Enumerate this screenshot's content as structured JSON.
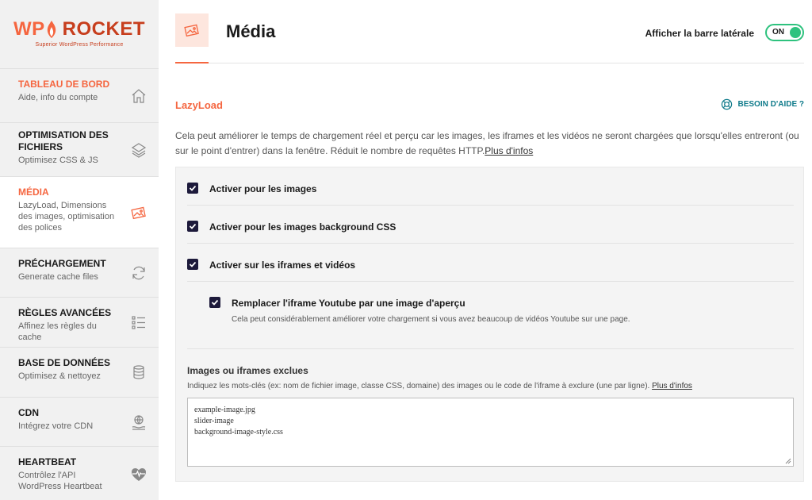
{
  "logo": {
    "wp": "WP",
    "rocket": "ROCKET",
    "tagline": "Superior WordPress Performance"
  },
  "sidebar": {
    "items": [
      {
        "title": "TABLEAU DE BORD",
        "desc": "Aide, info du compte",
        "icon": "home-icon"
      },
      {
        "title": "OPTIMISATION DES FICHIERS",
        "desc": "Optimisez CSS & JS",
        "icon": "layers-icon"
      },
      {
        "title": "MÉDIA",
        "desc": "LazyLoad, Dimensions des images, optimisation des polices",
        "icon": "images-icon"
      },
      {
        "title": "PRÉCHARGEMENT",
        "desc": "Generate cache files",
        "icon": "refresh-icon"
      },
      {
        "title": "RÈGLES AVANCÉES",
        "desc": "Affinez les règles du cache",
        "icon": "list-icon"
      },
      {
        "title": "BASE DE DONNÉES",
        "desc": "Optimisez & nettoyez",
        "icon": "database-icon"
      },
      {
        "title": "CDN",
        "desc": "Intégrez votre CDN",
        "icon": "globe-hand-icon"
      },
      {
        "title": "HEARTBEAT",
        "desc": "Contrôlez l'API WordPress Heartbeat",
        "icon": "heartbeat-icon"
      }
    ]
  },
  "header": {
    "title": "Média",
    "sidebar_toggle_label": "Afficher la barre latérale",
    "toggle_state": "ON"
  },
  "lazyload": {
    "title": "LazyLoad",
    "help": "BESOIN D'AIDE ?",
    "description": "Cela peut améliorer le temps de chargement réel et perçu car les images, les iframes et les vidéos ne seront chargées que lorsqu'elles entreront (ou sur le point d'entrer) dans la fenêtre. Réduit le nombre de requêtes HTTP.",
    "more_info": "Plus d'infos",
    "options": [
      {
        "label": "Activer pour les images",
        "checked": true
      },
      {
        "label": "Activer pour les images background CSS",
        "checked": true
      },
      {
        "label": "Activer sur les iframes et vidéos",
        "checked": true
      }
    ],
    "youtube": {
      "label": "Remplacer l'iframe Youtube par une image d'aperçu",
      "desc": "Cela peut considérablement améliorer votre chargement si vous avez beaucoup de vidéos Youtube sur une page.",
      "checked": true
    },
    "exclusions": {
      "title": "Images ou iframes exclues",
      "desc": "Indiquez les mots-clés (ex: nom de fichier image, classe CSS, domaine) des images ou le code de l'iframe à exclure (une par ligne).",
      "more_info": "Plus d'infos",
      "lines": [
        "example-image.jpg",
        "slider-image",
        "background-image-style.css"
      ]
    }
  },
  "colors": {
    "accent": "#f56640",
    "toggle_green": "#2ec27e",
    "checkbox": "#1d1a3b",
    "help_link": "#0e7a8a"
  }
}
